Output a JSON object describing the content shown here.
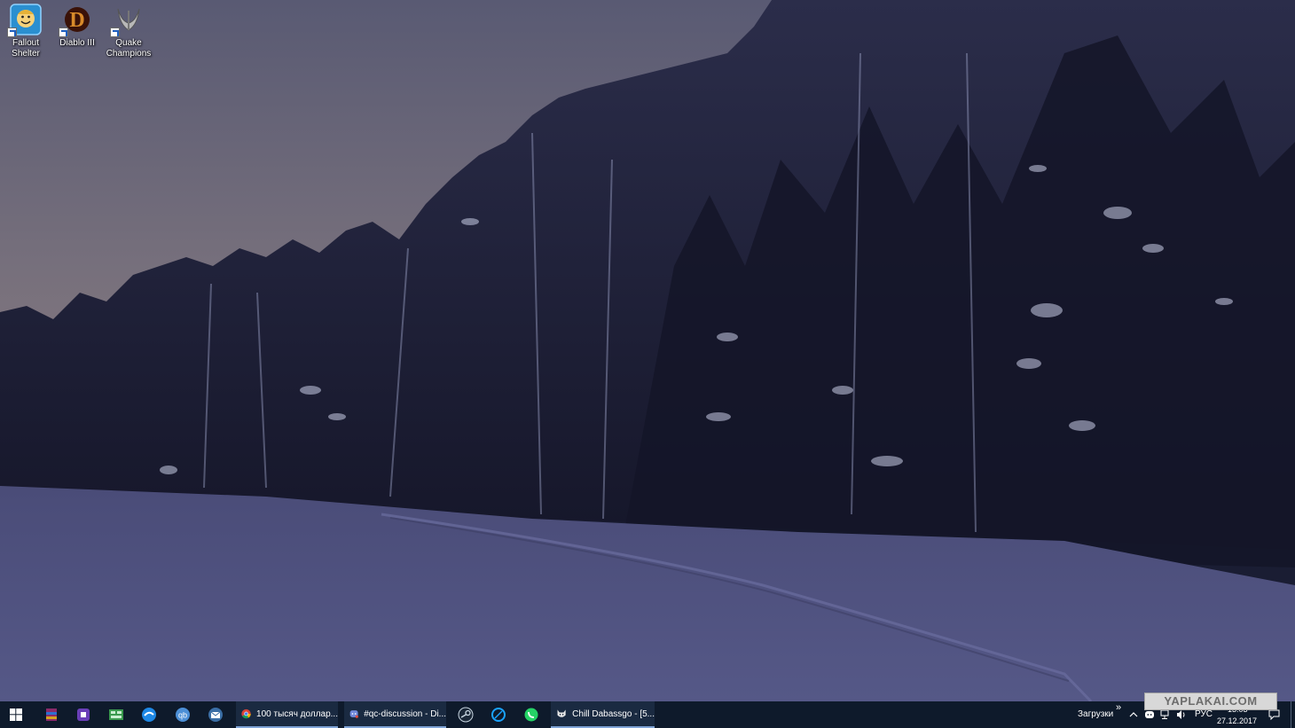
{
  "desktop": {
    "icons": [
      {
        "name": "fallout-shelter",
        "label": "Fallout Shelter"
      },
      {
        "name": "diablo-iii",
        "label": "Diablo III"
      },
      {
        "name": "quake-champions",
        "label": "Quake Champions"
      }
    ]
  },
  "taskbar": {
    "pinned": [
      "windows-start-icon",
      "winrar-icon",
      "processor-app-icon",
      "spreadsheet-app-icon",
      "sync-app-icon",
      "qbittorrent-icon",
      "mail-app-icon",
      "chrome-icon",
      "discord-icon",
      "steam-icon",
      "battle-net-icon",
      "whatsapp-icon",
      "cat-app-icon"
    ],
    "tasks": {
      "chrome": "100 тысяч доллар...",
      "discord": "#qc-discussion - Di...",
      "chill": "Chill Dabassgo - [5..."
    },
    "tray": {
      "downloads_label": "Загрузки",
      "chevron": "»",
      "language": "РУС",
      "time": "13:03",
      "date": "27.12.2017"
    }
  },
  "watermark": "YAPLAKAI.COM",
  "colors": {
    "taskbar_bg": "#0e1a2b",
    "active_task_underline": "#7fa3d6",
    "sky_top": "#575770",
    "sky_horizon": "#8c7c80",
    "snow": "#4d4f7d"
  }
}
